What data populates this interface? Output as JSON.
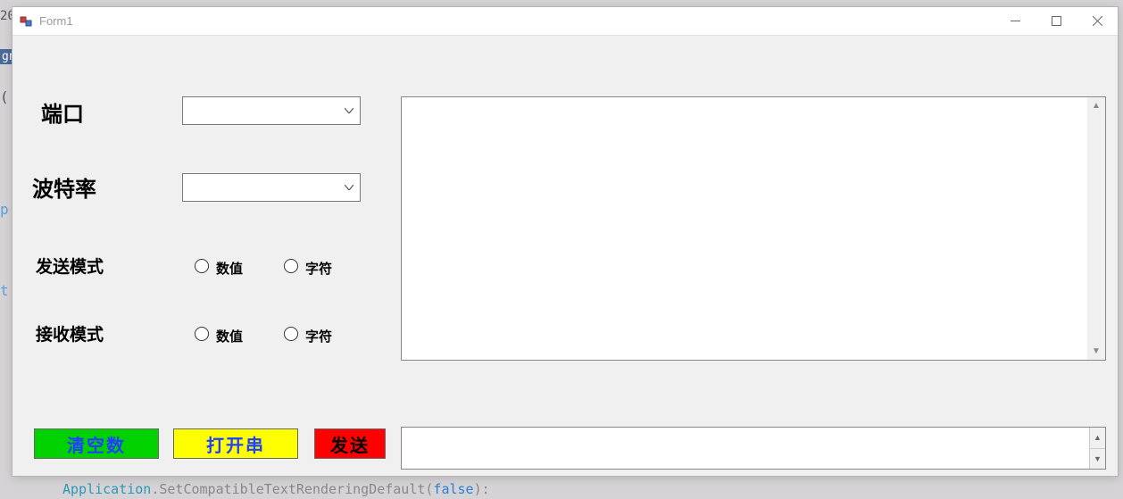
{
  "window": {
    "title": "Form1"
  },
  "labels": {
    "port": "端口",
    "baud": "波特率",
    "send_mode": "发送模式",
    "recv_mode": "接收模式"
  },
  "radio_labels": {
    "numeric": "数值",
    "char": "字符"
  },
  "combos": {
    "port_value": "",
    "baud_value": ""
  },
  "buttons": {
    "clear": "清空数",
    "open": "打开串",
    "send": "发送"
  },
  "textboxes": {
    "receive": "",
    "send": ""
  },
  "bg": {
    "frag_top": "20",
    "frag_gn": "gn",
    "frag_p": "p",
    "frag_t": "t",
    "frag_paren": "(",
    "code_line_1": "Application",
    "code_line_2": ".SetCompatibleTextRenderingDefault(",
    "code_line_3": "false",
    "code_line_4": "):"
  }
}
